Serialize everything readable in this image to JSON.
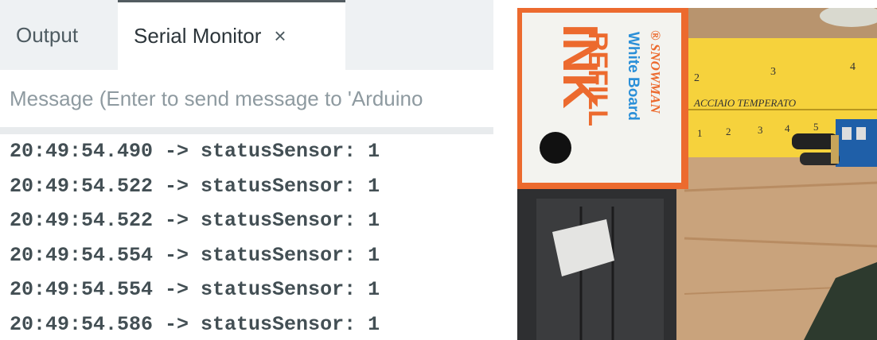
{
  "tabs": [
    {
      "label": "Output",
      "active": false
    },
    {
      "label": "Serial Monitor",
      "active": true
    }
  ],
  "tab_close_glyph": "×",
  "message": {
    "placeholder": "Message (Enter to send message to 'Arduino",
    "value": ""
  },
  "log_lines": [
    "20:49:54.490 -> statusSensor: 1",
    "20:49:54.522 -> statusSensor: 1",
    "20:49:54.522 -> statusSensor: 1",
    "20:49:54.554 -> statusSensor: 1",
    "20:49:54.554 -> statusSensor: 1",
    "20:49:54.586 -> statusSensor: 1"
  ],
  "photo": {
    "brand": "® SNOWMAN",
    "product": "White Board",
    "refill": "REFILL",
    "ink": "INK",
    "ruler_text": "ACCIAIO TEMPERATO",
    "ruler_top_numbers": [
      "2",
      "3",
      "4"
    ],
    "ruler_bottom_numbers": [
      "1",
      "2",
      "3",
      "4",
      "5"
    ]
  },
  "colors": {
    "tabbar_bg": "#eef1f3",
    "log_text": "#434f54",
    "placeholder": "#8e9aa0",
    "box_orange": "#ec6a2e",
    "ruler_yellow": "#f6d23c"
  }
}
